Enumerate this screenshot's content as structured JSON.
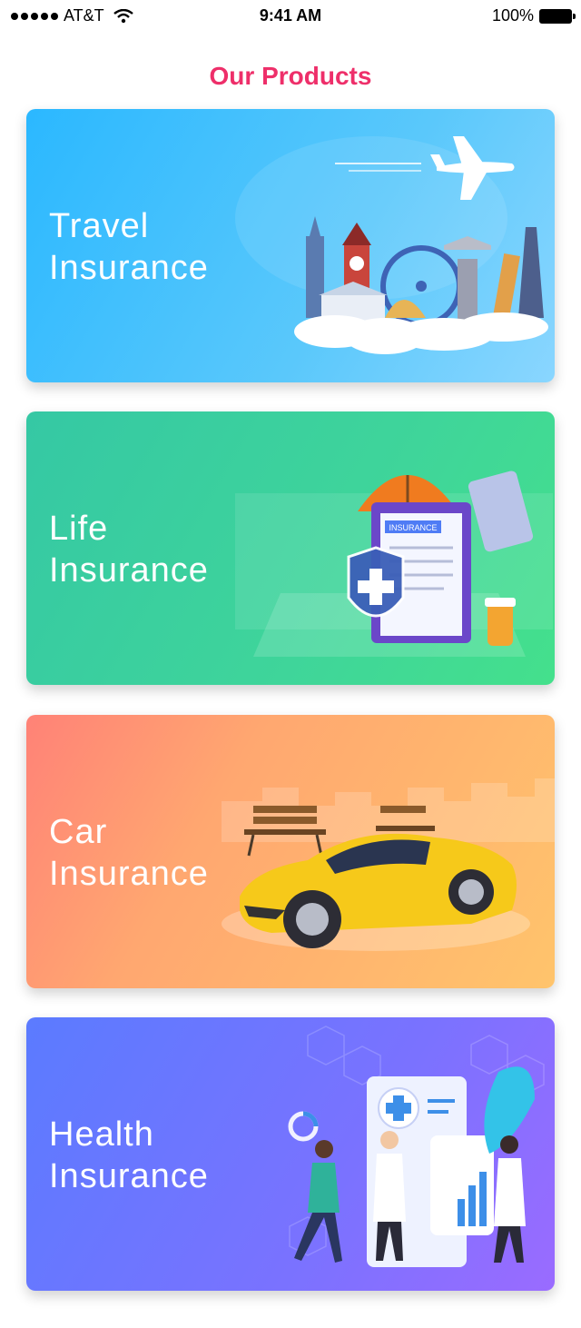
{
  "status_bar": {
    "carrier": "AT&T",
    "time": "9:41 AM",
    "battery": "100%"
  },
  "page": {
    "title": "Our Products"
  },
  "products": [
    {
      "line1": "Travel",
      "line2": "Insurance"
    },
    {
      "line1": "Life",
      "line2": "Insurance"
    },
    {
      "line1": "Car",
      "line2": "Insurance"
    },
    {
      "line1": "Health",
      "line2": "Insurance"
    }
  ],
  "illustrations": {
    "life_form_label": "INSURANCE"
  }
}
